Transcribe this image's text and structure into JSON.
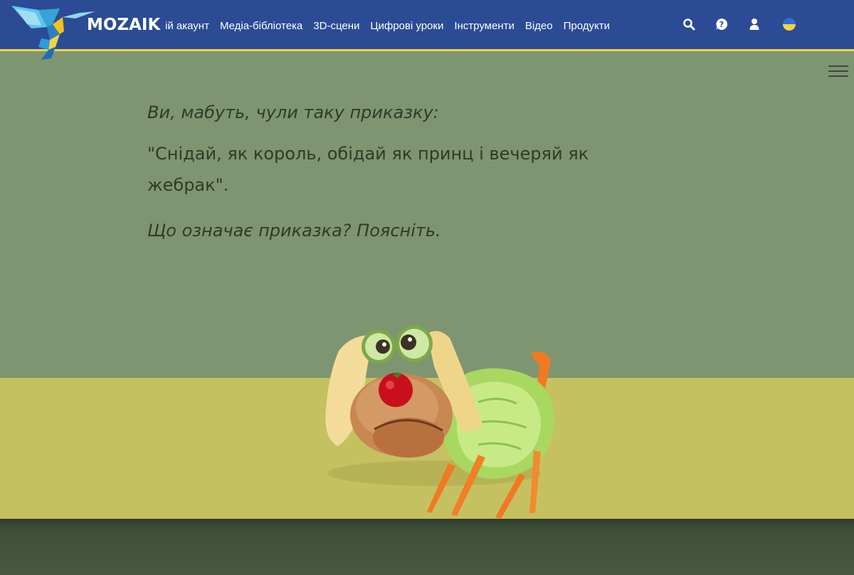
{
  "header": {
    "brand": "MOZAIK",
    "nav_items": [
      "ій акаунт",
      "Медіа-бібліотека",
      "3D-сцени",
      "Цифрові уроки",
      "Інструменти",
      "Відео",
      "Продукти"
    ],
    "icons": [
      "search-icon",
      "help-icon",
      "user-icon",
      "ukraine-flag-icon"
    ]
  },
  "content": {
    "line1": "Ви, мабуть, чули таку приказку:",
    "line2": "\"Снідай, як король, обідай як принц і вечеряй як жебрак\".",
    "line3": "Що означає приказка? Поясніть."
  },
  "colors": {
    "header_bg": "#2b4b95",
    "header_border": "#f3d24a",
    "upper_bg": "#7e9571",
    "lower_band": "#c6c160",
    "footer_band": "#3f4f38",
    "text": "#2f3b27"
  }
}
